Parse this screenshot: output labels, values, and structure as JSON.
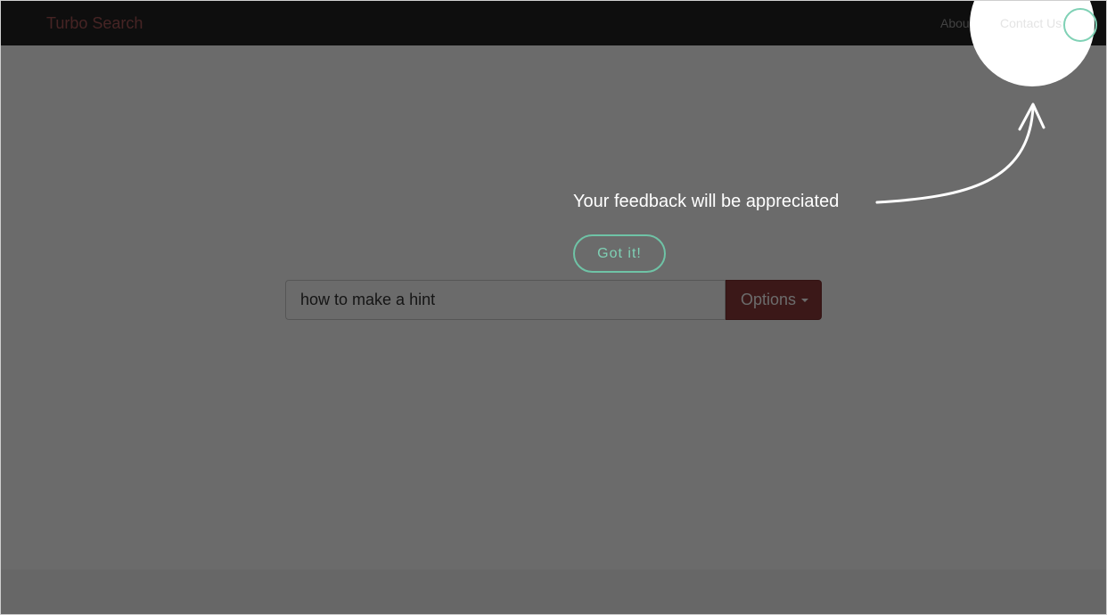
{
  "navbar": {
    "brand": "Turbo Search",
    "links": [
      "About",
      "Contact Us"
    ]
  },
  "search": {
    "value": "how to make a hint",
    "options_label": "Options"
  },
  "hint": {
    "message": "Your feedback will be appreciated",
    "confirm_label": "Got it!"
  },
  "colors": {
    "navbar_bg": "#222222",
    "brand": "#a85757",
    "options_button": "#8e3a3a",
    "hint_accent": "#7fd1b5",
    "overlay": "rgba(0,0,0,0.58)"
  },
  "icons": {
    "close": "close-icon",
    "dropdown": "caret-down-icon",
    "pointer": "arrow-icon"
  }
}
